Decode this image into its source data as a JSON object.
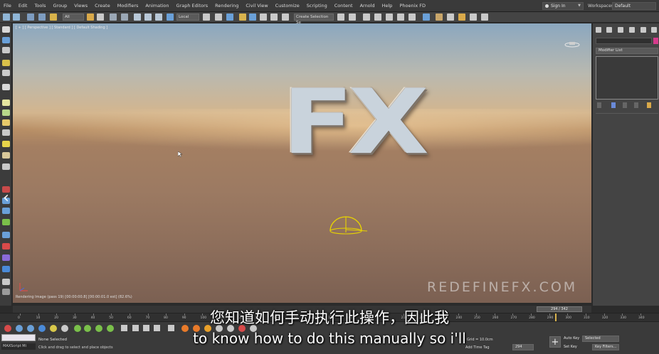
{
  "menubar": {
    "items": [
      "File",
      "Edit",
      "Tools",
      "Group",
      "Views",
      "Create",
      "Modifiers",
      "Animation",
      "Graph Editors",
      "Rendering",
      "Civil View",
      "Customize",
      "Scripting",
      "Content",
      "Arnold",
      "Help",
      "Phoenix FD"
    ],
    "sign_in": "Sign In",
    "workspaces_label": "Workspaces:",
    "workspace": "Default"
  },
  "toolbar": {
    "selection_filter": "All",
    "reference_coord": "Local",
    "selection_set": "Create Selection Se"
  },
  "viewport": {
    "label": "[ + ] [ Perspective ] [ Standard ] [ Default Shading ]",
    "scene_text": "FX",
    "watermark": "REDEFINEFX.COM",
    "render_status": "Rendering Image (pass 19) [00:00:00.8] [00:00:01.0 est]   (82.6%)"
  },
  "command_panel": {
    "modifier_list": "Modifier List",
    "object_color": "#d63b8c"
  },
  "timeline": {
    "frame_display": "294 / 342",
    "ticks": [
      "0",
      "10",
      "20",
      "30",
      "40",
      "50",
      "60",
      "70",
      "80",
      "90",
      "100",
      "110",
      "120",
      "130",
      "140",
      "150",
      "160",
      "170",
      "180",
      "190",
      "200",
      "210",
      "220",
      "230",
      "240",
      "250",
      "260",
      "270",
      "280",
      "290",
      "300",
      "310",
      "320",
      "330",
      "340"
    ]
  },
  "status": {
    "script_label": "MAXScript Mi",
    "selection": "None Selected",
    "hint": "Click and drag to select and place objects",
    "grid": "Grid = 10.0cm",
    "add_time_tag": "Add Time Tag",
    "frame_field": "294",
    "auto_key": "Auto Key",
    "set_key": "Set Key",
    "key_mode": "Selected",
    "key_filters": "Key Filters..."
  },
  "subtitles": {
    "zh": "您知道如何手动执行此操作，因此我",
    "en": "to know how to do this manually so i'll"
  }
}
